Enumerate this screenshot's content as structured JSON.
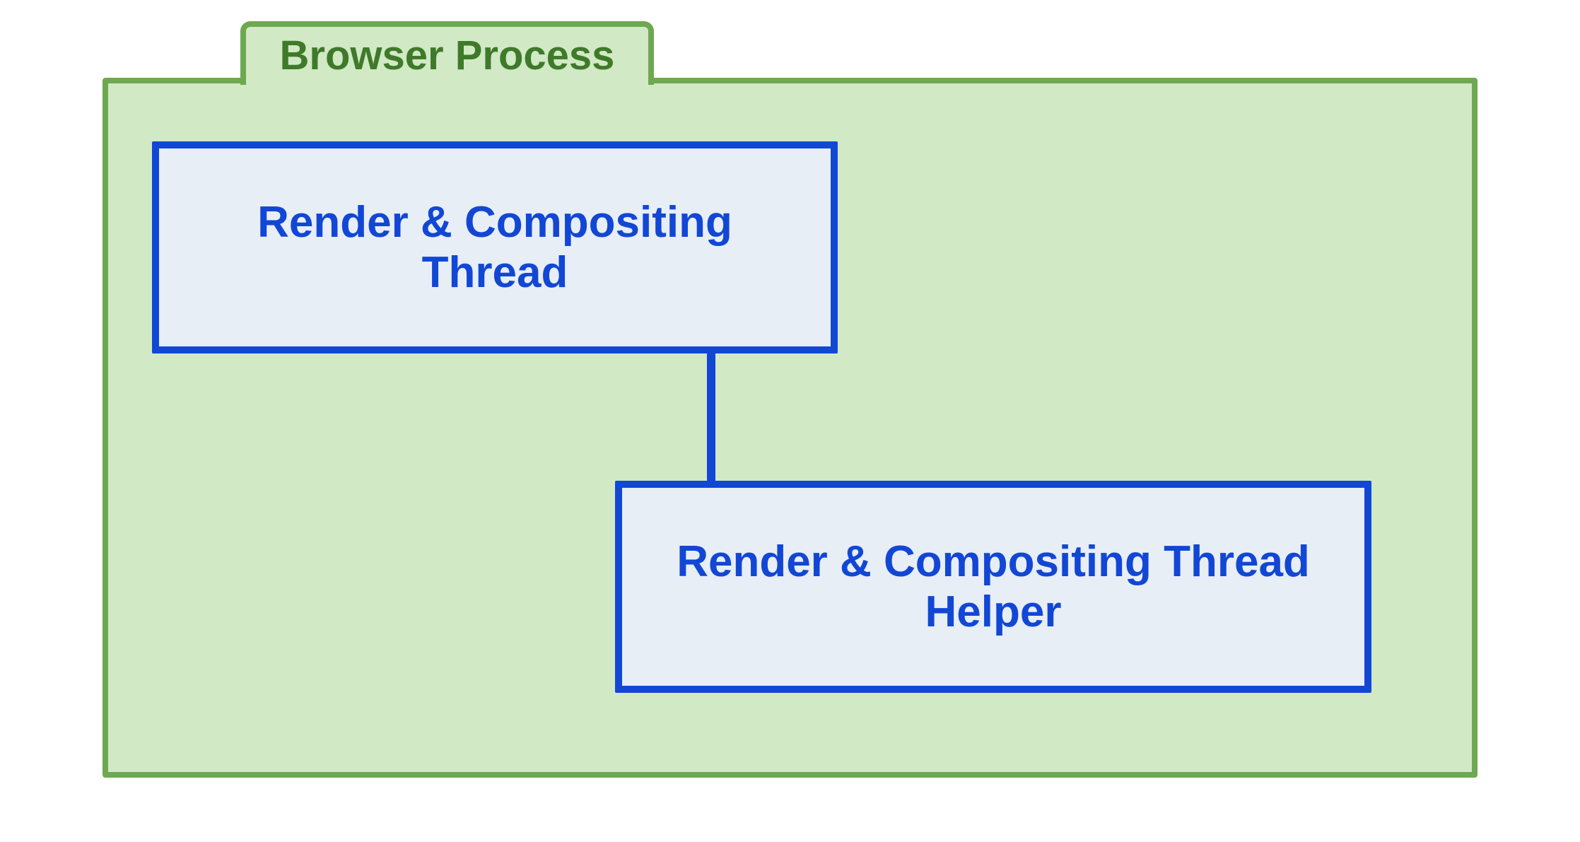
{
  "process": {
    "title": "Browser Process",
    "threads": [
      {
        "label": "Render & Compositing Thread"
      },
      {
        "label": "Render & Compositing Thread Helper"
      }
    ]
  },
  "colors": {
    "process_border": "#6ea850",
    "process_fill": "#d1e9c5",
    "process_text": "#3f7a2a",
    "thread_border": "#1247d5",
    "thread_fill": "#e7eef6",
    "thread_text": "#1247d5"
  }
}
